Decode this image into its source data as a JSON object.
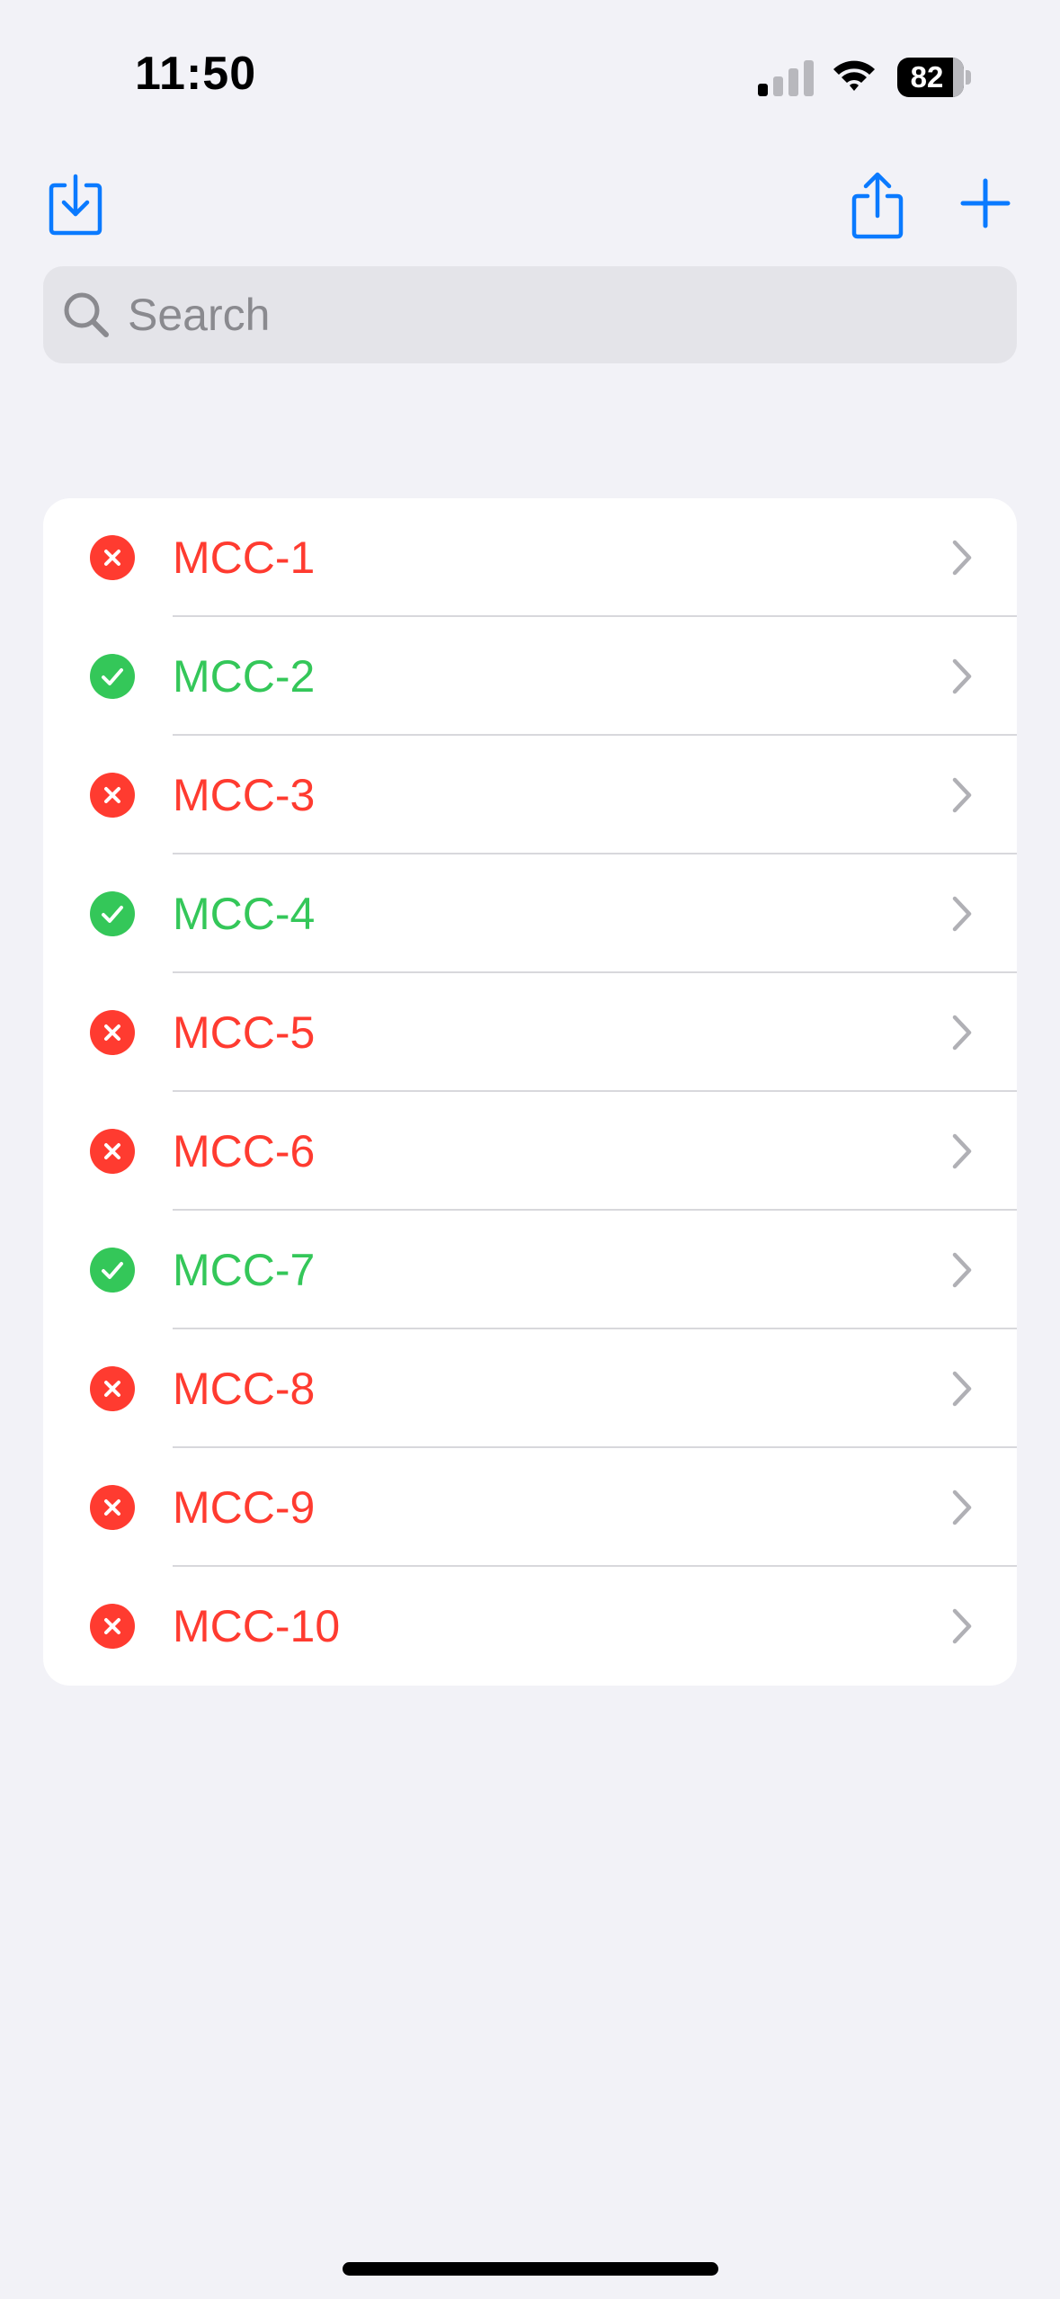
{
  "status_bar": {
    "time": "11:50",
    "battery_level": "82",
    "signal_bars_active": 1,
    "signal_bars_total": 4
  },
  "toolbar": {
    "left_icon": "import-icon",
    "share_icon": "share-icon",
    "add_icon": "plus-icon"
  },
  "search": {
    "placeholder": "Search",
    "value": ""
  },
  "colors": {
    "accent": "#0a7aff",
    "fail": "#ff3b30",
    "pass": "#34c759",
    "chevron": "#b0b0b5"
  },
  "items": [
    {
      "label": "MCC-1",
      "status": "fail"
    },
    {
      "label": "MCC-2",
      "status": "pass"
    },
    {
      "label": "MCC-3",
      "status": "fail"
    },
    {
      "label": "MCC-4",
      "status": "pass"
    },
    {
      "label": "MCC-5",
      "status": "fail"
    },
    {
      "label": "MCC-6",
      "status": "fail"
    },
    {
      "label": "MCC-7",
      "status": "pass"
    },
    {
      "label": "MCC-8",
      "status": "fail"
    },
    {
      "label": "MCC-9",
      "status": "fail"
    },
    {
      "label": "MCC-10",
      "status": "fail"
    }
  ]
}
